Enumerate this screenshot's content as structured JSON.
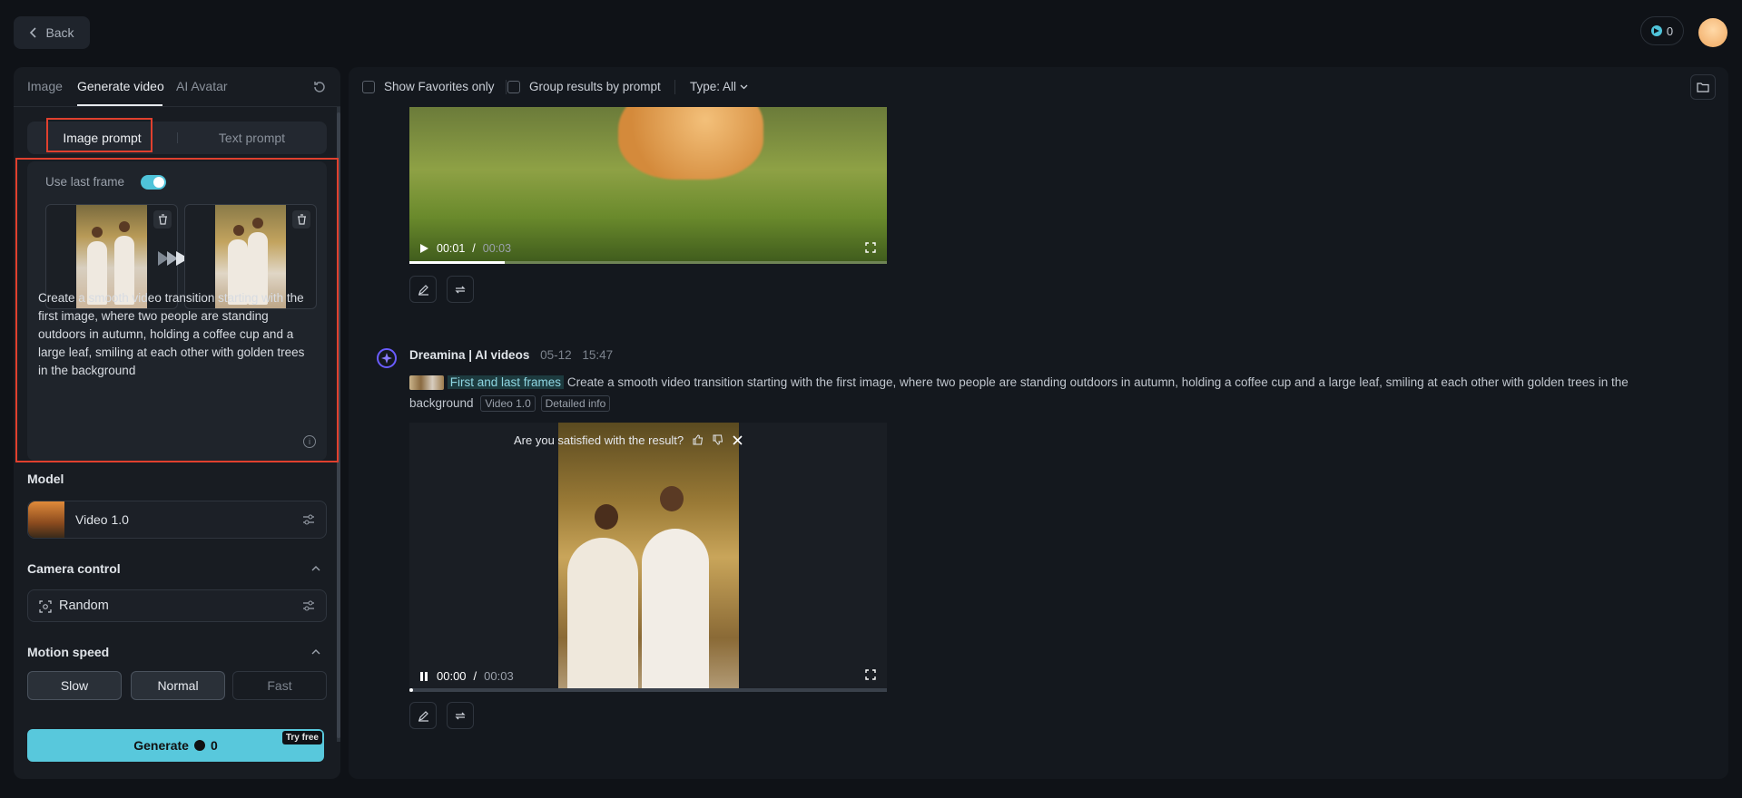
{
  "topbar": {
    "back_label": "Back",
    "credits": "0"
  },
  "sidebar": {
    "tabs": [
      {
        "label": "Image"
      },
      {
        "label": "Generate video"
      },
      {
        "label": "AI Avatar"
      }
    ],
    "prompt_modes": {
      "image": "Image prompt",
      "text": "Text prompt"
    },
    "use_last_frame_label": "Use last frame",
    "prompt_text": "Create a smooth video transition starting with the first image, where two people are standing outdoors in autumn, holding a coffee cup and a large leaf, smiling at each other with golden trees in the background",
    "model_label": "Model",
    "model_value": "Video 1.0",
    "camera_label": "Camera control",
    "camera_value": "Random",
    "motion_label": "Motion speed",
    "speeds": [
      "Slow",
      "Normal",
      "Fast"
    ],
    "generate_label": "Generate",
    "generate_cost": "0",
    "try_free": "Try free"
  },
  "main": {
    "filters": {
      "favorites": "Show Favorites only",
      "group": "Group results by prompt",
      "type": "Type: All"
    },
    "video1": {
      "time_current": "00:01",
      "time_total": "00:03"
    },
    "result": {
      "bot_name": "Dreamina | AI videos",
      "date": "05-12",
      "time": "15:47",
      "frames_tag": "First and last frames",
      "prompt": "Create a smooth video transition starting with the first image, where two people are standing outdoors in autumn, holding a coffee cup and a large leaf, smiling at each other with golden trees in the background",
      "model_tag": "Video 1.0",
      "detail_tag": "Detailed info",
      "satisfaction": "Are you satisfied with the result?",
      "time_current": "00:00",
      "time_total": "00:03"
    }
  },
  "colors": {
    "accent": "#58c8dc",
    "highlight": "#e0402e"
  }
}
